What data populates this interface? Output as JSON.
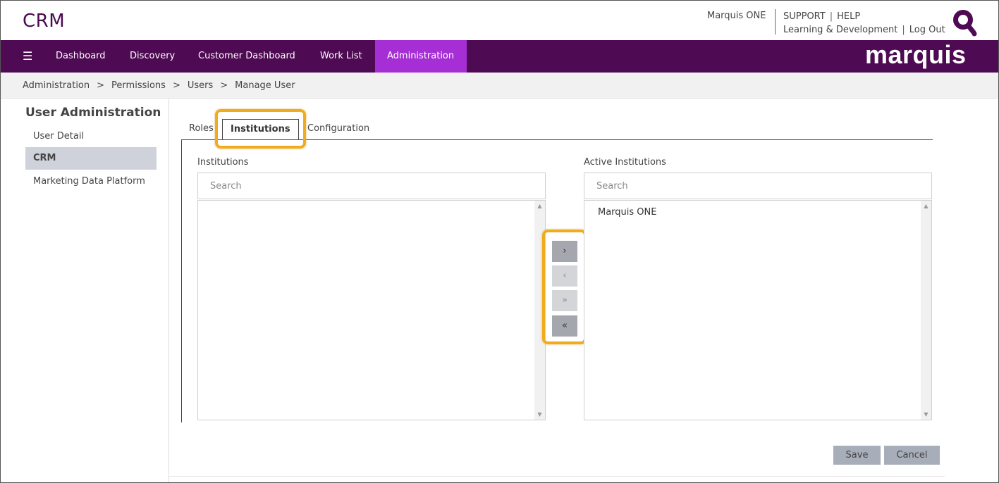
{
  "header": {
    "app_title": "CRM",
    "org_name": "Marquis ONE",
    "links": [
      "SUPPORT",
      "HELP",
      "Learning & Development",
      "Log Out"
    ],
    "brand_color": "#4e0a52",
    "logo_icon": "magnifier-q-icon"
  },
  "nav": {
    "menu_icon": "hamburger-icon",
    "items": [
      "Dashboard",
      "Discovery",
      "Customer Dashboard",
      "Work List",
      "Administration"
    ],
    "active": "Administration",
    "active_color": "#a52fd4",
    "brand": "marquis"
  },
  "breadcrumb": [
    "Administration",
    "Permissions",
    "Users",
    "Manage User"
  ],
  "sidebar": {
    "title": "User Administration",
    "items": [
      "User Detail",
      "CRM",
      "Marketing Data Platform"
    ],
    "active": "CRM"
  },
  "tabs": {
    "items": [
      "Roles",
      "Institutions",
      "Configuration"
    ],
    "active": "Institutions"
  },
  "institutions": {
    "label": "Institutions",
    "search_placeholder": "Search",
    "items": []
  },
  "active_institutions": {
    "label": "Active Institutions",
    "search_placeholder": "Search",
    "items": [
      "Marquis ONE"
    ]
  },
  "transfer": {
    "move_right": "›",
    "move_left": "‹",
    "move_all_right": "»",
    "move_all_left": "«"
  },
  "actions": {
    "save": "Save",
    "cancel": "Cancel"
  },
  "highlight_color": "#f0ac1c"
}
